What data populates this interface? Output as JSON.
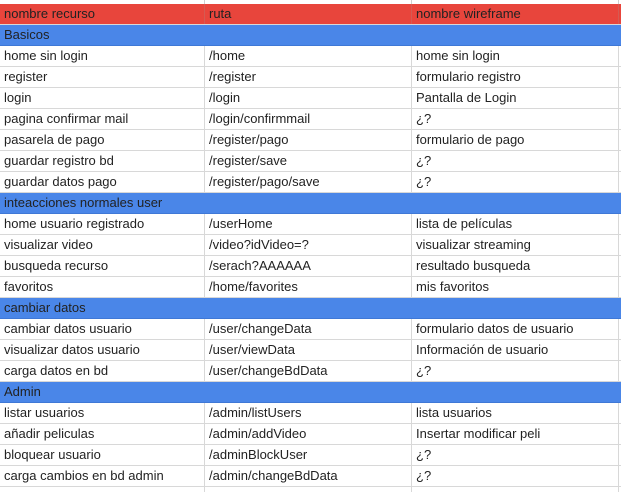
{
  "header": {
    "col1": "nombre recurso",
    "col2": "ruta",
    "col3": "nombre wireframe"
  },
  "colors": {
    "header_bg": "#e8453c",
    "section_bg": "#4a86e8",
    "grid_line": "#d8d8d8"
  },
  "sections": [
    {
      "title": "Basicos",
      "rows": [
        {
          "nombre": "home sin login",
          "ruta": "/home",
          "wireframe": "home sin login"
        },
        {
          "nombre": "register",
          "ruta": "/register",
          "wireframe": "formulario registro"
        },
        {
          "nombre": "login",
          "ruta": "/login",
          "wireframe": "Pantalla de Login"
        },
        {
          "nombre": "pagina confirmar mail",
          "ruta": "/login/confirmmail",
          "wireframe": "¿?"
        },
        {
          "nombre": "pasarela de pago",
          "ruta": "/register/pago",
          "wireframe": "formulario de pago"
        },
        {
          "nombre": "guardar registro bd",
          "ruta": "/register/save",
          "wireframe": "¿?"
        },
        {
          "nombre": "guardar datos pago",
          "ruta": "/register/pago/save",
          "wireframe": "¿?"
        }
      ]
    },
    {
      "title": "inteacciones normales user",
      "rows": [
        {
          "nombre": "home usuario registrado",
          "ruta": "/userHome",
          "wireframe": "lista de películas"
        },
        {
          "nombre": "visualizar video",
          "ruta": "/video?idVideo=?",
          "wireframe": "visualizar streaming"
        },
        {
          "nombre": "busqueda recurso",
          "ruta": "/serach?AAAAAA",
          "wireframe": "resultado busqueda"
        },
        {
          "nombre": "favoritos",
          "ruta": "/home/favorites",
          "wireframe": "mis favoritos"
        }
      ]
    },
    {
      "title": "cambiar datos",
      "rows": [
        {
          "nombre": "cambiar datos usuario",
          "ruta": "/user/changeData",
          "wireframe": "formulario datos de usuario"
        },
        {
          "nombre": "visualizar datos usuario",
          "ruta": "/user/viewData",
          "wireframe": "Información de usuario"
        },
        {
          "nombre": "carga datos en bd",
          "ruta": "/user/changeBdData",
          "wireframe": "¿?"
        }
      ]
    },
    {
      "title": "Admin",
      "rows": [
        {
          "nombre": "listar usuarios",
          "ruta": "/admin/listUsers",
          "wireframe": "lista usuarios"
        },
        {
          "nombre": "añadir peliculas",
          "ruta": "/admin/addVideo",
          "wireframe": "Insertar modificar peli"
        },
        {
          "nombre": "bloquear usuario",
          "ruta": "/adminBlockUser",
          "wireframe": "¿?"
        },
        {
          "nombre": "carga cambios en bd admin",
          "ruta": "/admin/changeBdData",
          "wireframe": "¿?"
        }
      ]
    }
  ]
}
